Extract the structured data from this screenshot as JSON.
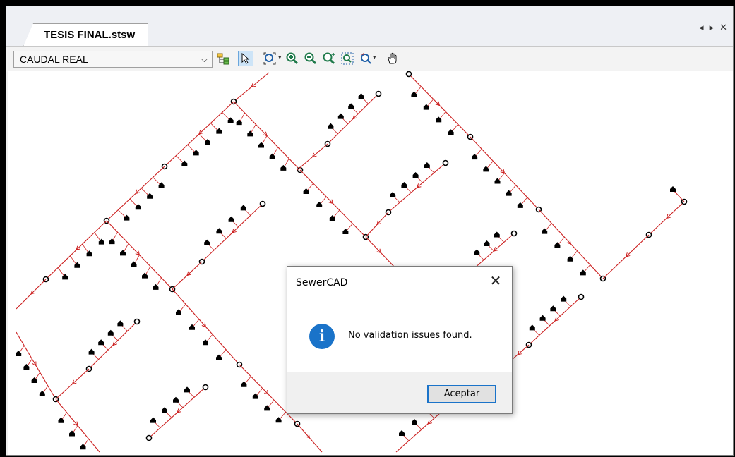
{
  "document": {
    "tab_title": "TESIS FINAL.stsw",
    "tab_controls": [
      "◂",
      "▸",
      "✕"
    ]
  },
  "toolbar": {
    "scenario_value": "CAUDAL REAL",
    "icons": [
      "scenario-tree-icon",
      "select-arrow-icon",
      "zoom-extents-icon",
      "zoom-in-icon",
      "zoom-out-icon",
      "zoom-realtime-icon",
      "zoom-window-icon",
      "zoom-previous-icon",
      "pan-hand-icon"
    ]
  },
  "colors": {
    "pipe": "#cc1f1f",
    "node": "#000000",
    "accent": "#1a73c9"
  },
  "dialog": {
    "title": "SewerCAD",
    "close_glyph": "✕",
    "icon": "info-icon",
    "message": "No validation issues found.",
    "ok_label": "Aceptar"
  }
}
